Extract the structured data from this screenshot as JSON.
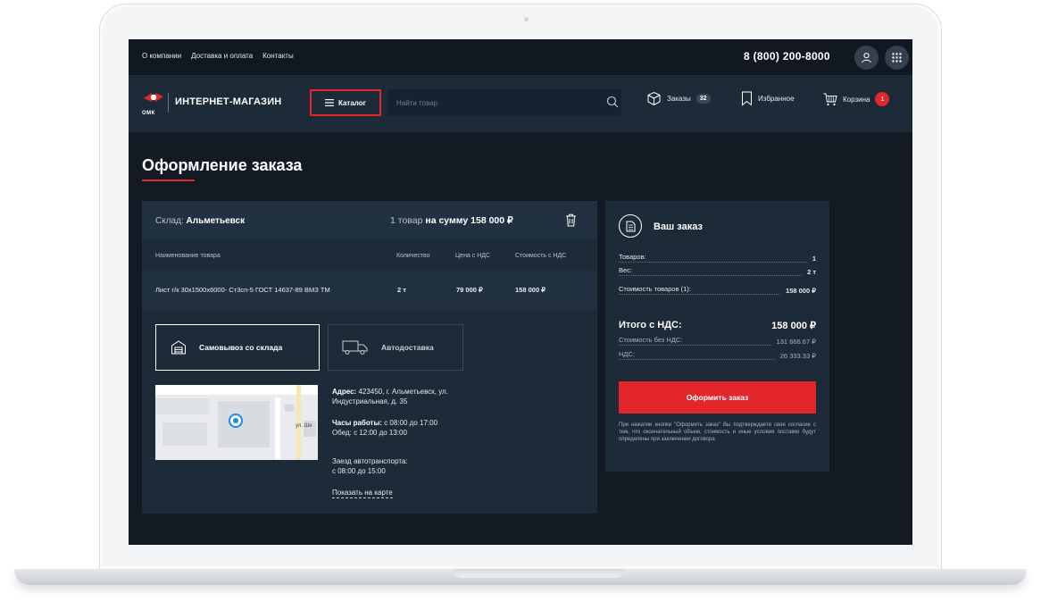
{
  "topbar": {
    "links": [
      "О компании",
      "Доставка и оплата",
      "Контакты"
    ],
    "phone": "8 (800) 200-8000",
    "icons": [
      "user-icon",
      "apps-grid-icon"
    ]
  },
  "header": {
    "logo_caption": "ОМК",
    "logo_title": "ИНТЕРНЕТ-МАГАЗИН",
    "catalog_label": "Каталог",
    "search_placeholder": "Найти товар",
    "orders_label": "Заказы",
    "orders_count": "32",
    "favorites_label": "Избранное",
    "cart_label": "Корзина",
    "cart_count": "1"
  },
  "page": {
    "title": "Оформление заказа"
  },
  "warehouse": {
    "label": "Склад:",
    "name": "Альметьевск",
    "items_text": "1 товар",
    "sum_text": "на сумму 158 000 ₽",
    "columns": [
      "Наименование товара",
      "Количество",
      "Цена с НДС",
      "Стоимость с НДС"
    ],
    "rows": [
      {
        "name": "Лист г/к 30x1500x6000- Ст3сп-5 ГОСТ 14637-89 ВМЗ ТМ",
        "qty": "2 т",
        "price": "79 000 ₽",
        "cost": "158 000 ₽"
      }
    ]
  },
  "delivery": {
    "pickup_label": "Самовывоз со склада",
    "delivery_label": "Автодоставка",
    "map_street": "ул. Ше",
    "address_label": "Адрес:",
    "address_line1": "423450, г. Альметьевск, ул.",
    "address_line2": "Индустриальная, д. 35",
    "hours_label": "Часы работы:",
    "hours_value": "с 08:00 до 17:00",
    "lunch": "Обед: с 12:00 до 13:00",
    "transport_label": "Заезд автотранспорта:",
    "transport_hours": "с 08:00 до 15:00",
    "map_link": "Показать на карте"
  },
  "summary": {
    "title": "Ваш заказ",
    "goods_label": "Товаров:",
    "goods_value": "1",
    "weight_label": "Вес:",
    "weight_value": "2 т",
    "cost_label": "Стоимость товаров (1):",
    "cost_value": "158 000 ₽",
    "total_label": "Итого с НДС:",
    "total_value": "158 000 ₽",
    "no_vat_label": "Стоимость без НДС:",
    "no_vat_value": "131 666.67 ₽",
    "vat_label": "НДС:",
    "vat_value": "26 333.33 ₽",
    "order_button": "Оформить заказ",
    "disclaimer": "При нажатии кнопки \"Оформить заказ\" Вы подтверждаете свое согласие с тем, что окончательный объем, стоимость и иные условия поставки будут определены при заключении договора"
  },
  "colors": {
    "accent": "#e2262b",
    "background": "#131a24",
    "panel": "#1d2a38"
  }
}
